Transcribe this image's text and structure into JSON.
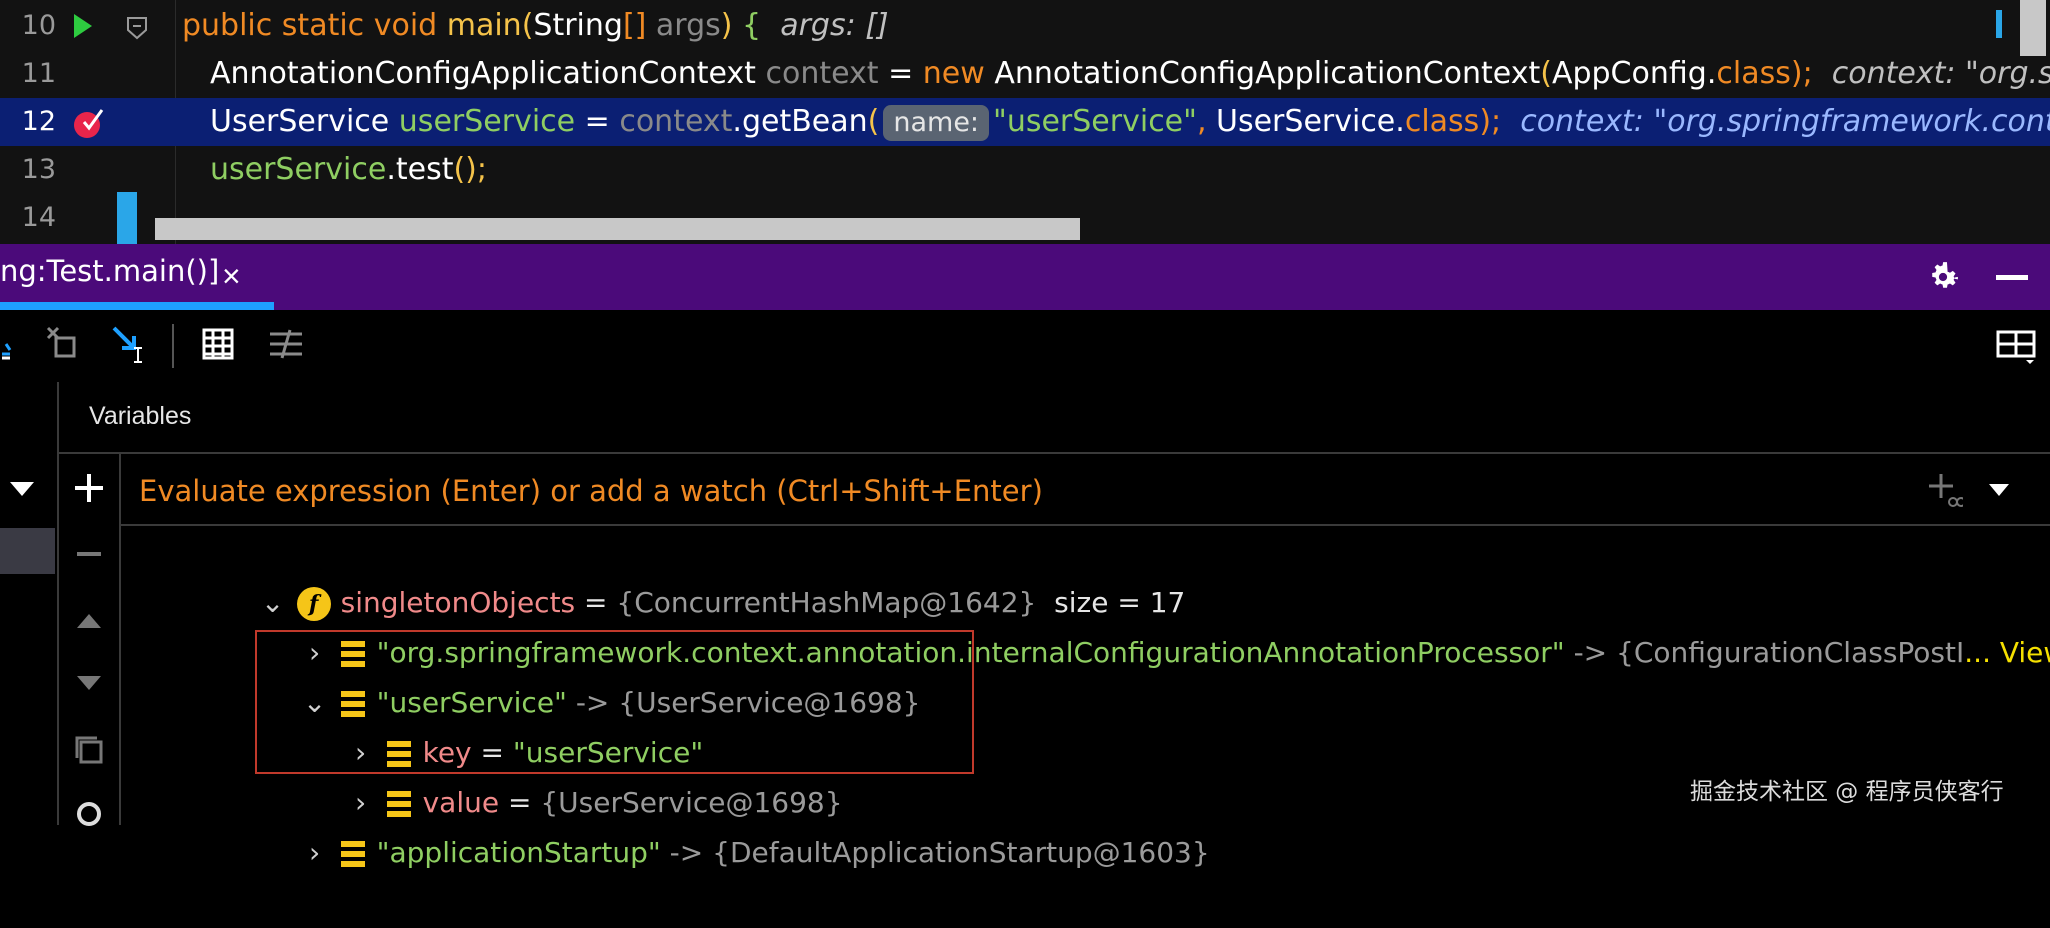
{
  "editor": {
    "lines": [
      {
        "num": "10",
        "code": {
          "kw1": "public static void ",
          "fn": "main",
          "p1": "(",
          "type": "String",
          "arr": "[] ",
          "arg": "args",
          "p2": ") ",
          "brace": "{",
          "hint": "  args: []"
        }
      },
      {
        "num": "11",
        "code": {
          "type": "AnnotationConfigApplicationContext ",
          "var": "context",
          "eq": " = ",
          "kw": "new ",
          "ctor": "AnnotationConfigApplicationContext",
          "p1": "(",
          "cls": "AppConfig",
          "dot": ".",
          "classkw": "class",
          "p2": ");",
          "hint": "  context: \"org.sprin"
        }
      },
      {
        "num": "12",
        "code": {
          "type": "UserService ",
          "var": "userService",
          "eq": " = ",
          "ctx": "context",
          "call": ".getBean",
          "p1": "(",
          "badge": "name:",
          "str": "\"userService\"",
          "comma": ", ",
          "cls": "UserService",
          "dot": ".",
          "classkw": "class",
          "p2": ");",
          "hint": "  context: \"org.springframework.context.ar"
        }
      },
      {
        "num": "13",
        "code": {
          "var": "userService",
          "call": ".test",
          "p": "();"
        }
      },
      {
        "num": "14"
      }
    ]
  },
  "debug_tab": {
    "title": "ng:Test.main()]",
    "close": "×"
  },
  "variables": {
    "title": "Variables",
    "eval_placeholder": "Evaluate expression (Enter) or add a watch (Ctrl+Shift+Enter)",
    "rows": [
      {
        "name": "singletonObjects",
        "eq": " = ",
        "value": "{ConcurrentHashMap@1642}",
        "extra": "  size = 17"
      },
      {
        "name": "\"org.springframework.context.annotation.internalConfigurationAnnotationProcessor\"",
        "arrow": " -> ",
        "value": "{ConfigurationClassPostI",
        "view": "... View"
      },
      {
        "name": "\"userService\"",
        "arrow": " -> ",
        "value": "{UserService@1698}"
      },
      {
        "name": "key",
        "eq": " = ",
        "value": "\"userService\""
      },
      {
        "name": "value",
        "eq": " = ",
        "value": "{UserService@1698}"
      },
      {
        "name": "\"applicationStartup\"",
        "arrow": " -> ",
        "value": "{DefaultApplicationStartup@1603}"
      }
    ]
  },
  "watermark": "掘金技术社区 @ 程序员侠客行",
  "colors": {
    "tabbar": "#4b0a7a",
    "highlight": "#0b1f73",
    "accent": "#1ea0ff"
  }
}
